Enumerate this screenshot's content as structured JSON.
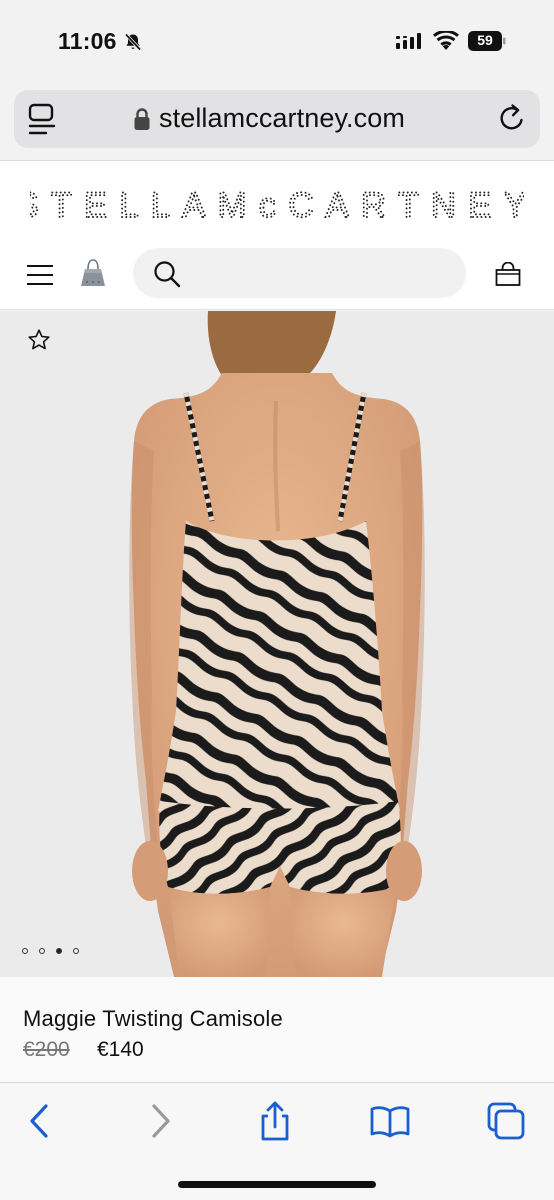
{
  "status_bar": {
    "time": "11:06",
    "battery": "59"
  },
  "browser": {
    "url": "stellamccartney.com"
  },
  "site": {
    "brand": "STELLAMcCARTNEY",
    "search_placeholder": ""
  },
  "product": {
    "name": "Maggie Twisting Camisole",
    "original_price": "€200",
    "sale_price": "€140",
    "carousel_count": 4,
    "carousel_active_index": 2
  },
  "toolbar": {
    "buttons": [
      "back",
      "forward",
      "share",
      "bookmarks",
      "tabs"
    ]
  },
  "colors": {
    "accent": "#1a5fd0",
    "disabled": "#9a9a9a",
    "background": "#f2f2f2"
  }
}
